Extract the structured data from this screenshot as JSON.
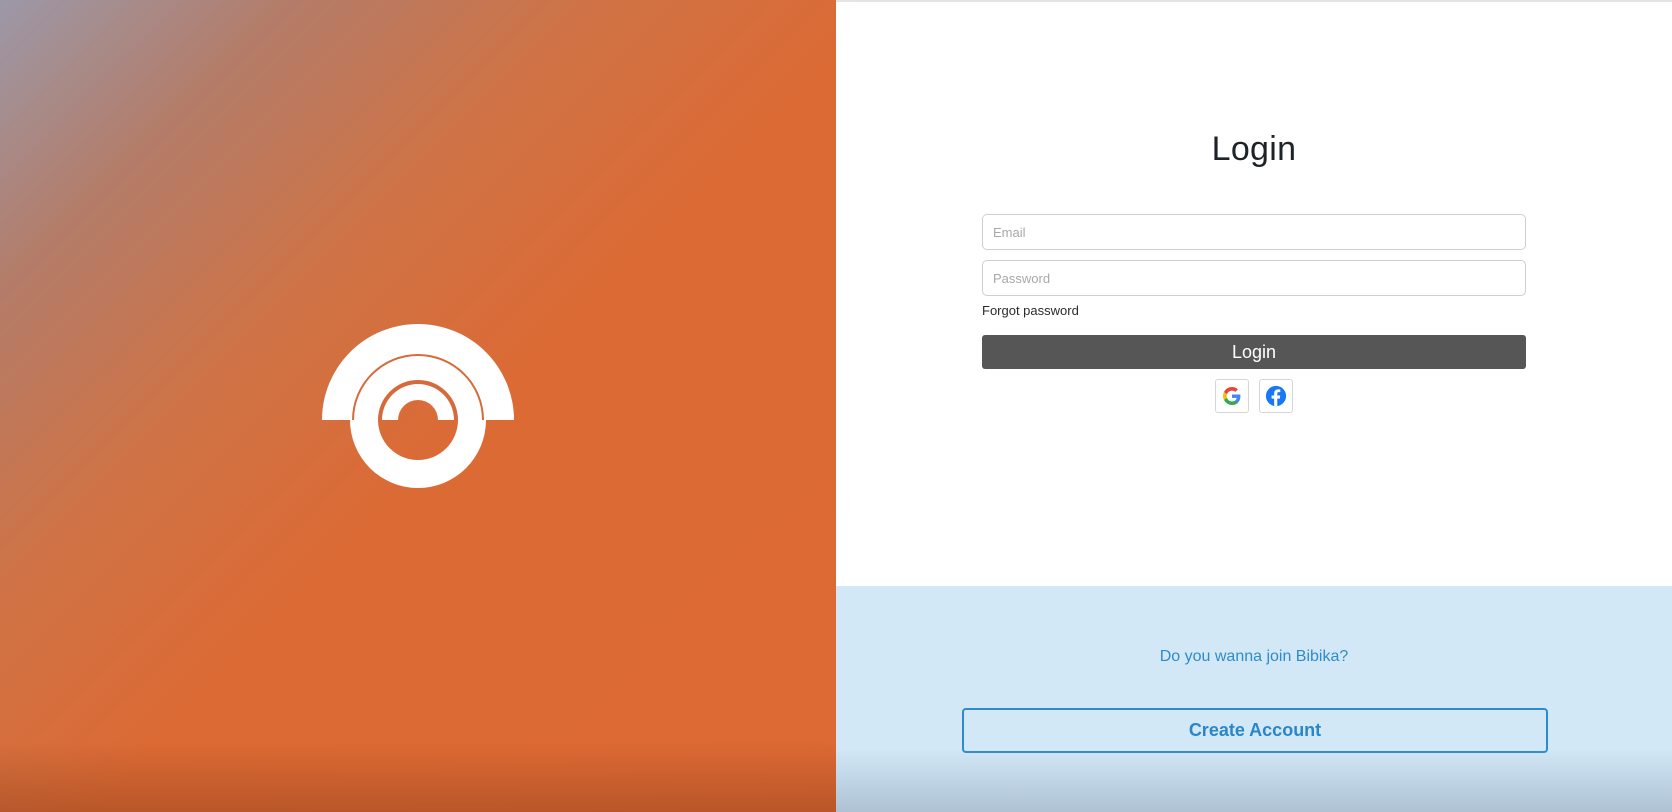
{
  "brand": {
    "logo_icon": "bibika-logo-icon",
    "colors": {
      "panel_start": "#9c98a8",
      "panel_accent": "#dd6934",
      "logo": "#ffffff"
    }
  },
  "login": {
    "title": "Login",
    "email": {
      "placeholder": "Email",
      "value": ""
    },
    "password": {
      "placeholder": "Password",
      "value": ""
    },
    "forgot_password_label": "Forgot password",
    "login_button_label": "Login",
    "social": [
      {
        "icon": "google-icon"
      },
      {
        "icon": "facebook-icon"
      }
    ],
    "colors": {
      "button_bg": "#565656",
      "button_text": "#ffffff"
    }
  },
  "signup": {
    "prompt": "Do you wanna join Bibika?",
    "create_account_label": "Create Account",
    "colors": {
      "section_bg": "#d3e8f7",
      "accent": "#2e8ccc"
    }
  }
}
